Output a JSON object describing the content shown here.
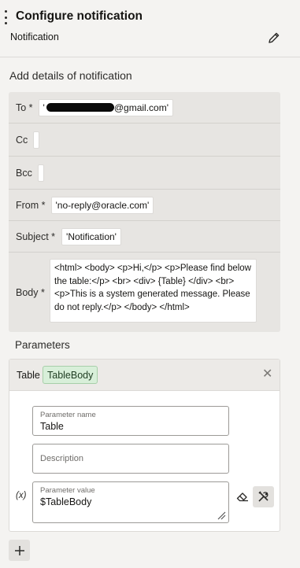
{
  "header": {
    "title": "Configure notification",
    "subtitle": "Notification"
  },
  "details": {
    "heading": "Add details of notification",
    "to": {
      "label": "To *",
      "prefix": "'",
      "suffix": "@gmail.com'"
    },
    "cc": {
      "label": "Cc"
    },
    "bcc": {
      "label": "Bcc"
    },
    "from": {
      "label": "From *",
      "value": "'no-reply@oracle.com'"
    },
    "subject": {
      "label": "Subject *",
      "value": "'Notification'"
    },
    "body": {
      "label": "Body *",
      "value": "<html> <body> <p>Hi,</p> <p>Please find below the table:</p> <br> <div> {Table} </div> <br> <p>This is a system generated message. Please do not reply.</p> </body> </html>"
    }
  },
  "parameters": {
    "heading": "Parameters",
    "item": {
      "name": "Table",
      "tag": "TableBody",
      "name_field": {
        "label": "Parameter name",
        "value": "Table"
      },
      "description_field": {
        "placeholder": "Description"
      },
      "value_field": {
        "label": "Parameter value",
        "value": "$TableBody"
      },
      "fx_label": "(x)"
    }
  },
  "icons": {
    "menu": "kebab-icon",
    "edit": "pencil-icon",
    "close": "close-icon",
    "clear": "eraser-icon",
    "tools": "tools-icon",
    "add": "plus-icon"
  },
  "colors": {
    "background": "#f4f3f1",
    "fields_group": "#e7e5e2",
    "tag_bg": "#d8efd9",
    "tag_border": "#a7cfa9"
  }
}
